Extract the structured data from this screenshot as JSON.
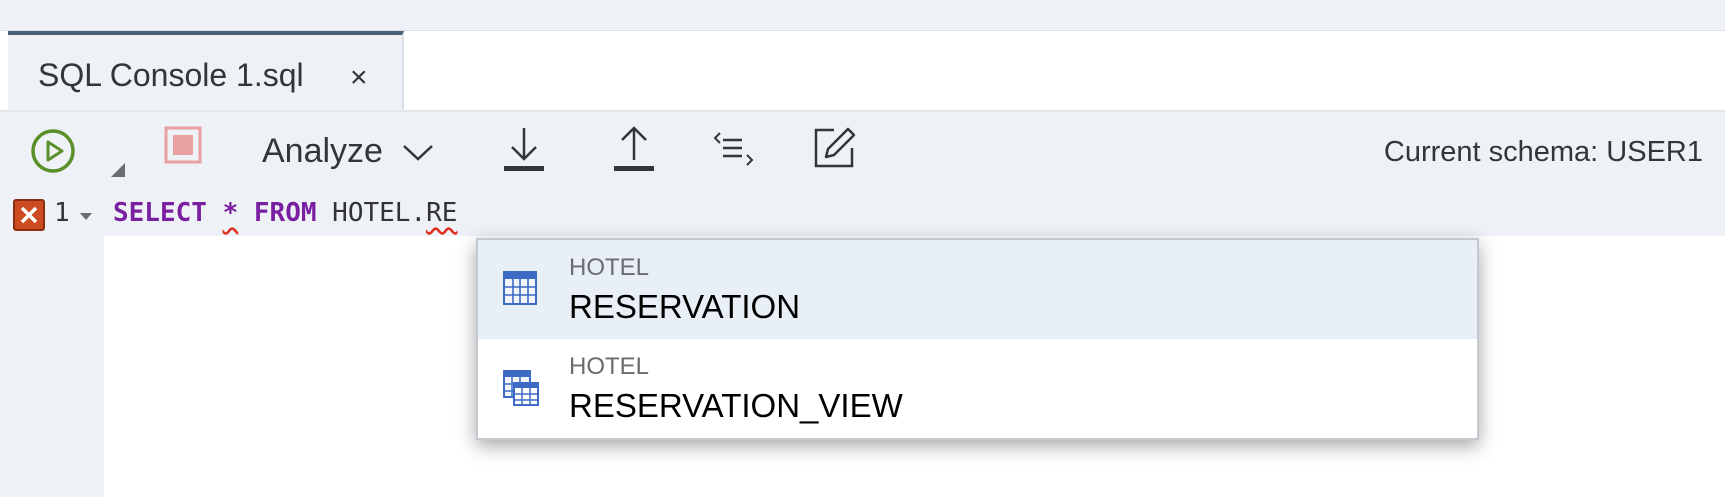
{
  "tabs": [
    {
      "label": "SQL Console 1.sql",
      "close": "×"
    }
  ],
  "toolbar": {
    "run_icon": "run-icon",
    "stop_icon": "stop-icon",
    "analyze_label": "Analyze",
    "download_icon": "download-icon",
    "upload_icon": "upload-icon",
    "format_icon": "format-code-icon",
    "edit_icon": "edit-icon",
    "current_schema": "Current schema: USER1"
  },
  "editor": {
    "line_number": "1",
    "code": {
      "select": "SELECT",
      "star": "*",
      "from": "FROM",
      "table_prefix": "HOTEL.",
      "partial": "RE"
    },
    "error_color": "#cc4b21"
  },
  "autocomplete": {
    "items": [
      {
        "schema": "HOTEL",
        "name": "RESERVATION",
        "icon": "table-icon",
        "selected": true
      },
      {
        "schema": "HOTEL",
        "name": "RESERVATION_VIEW",
        "icon": "view-icon",
        "selected": false
      }
    ]
  },
  "colors": {
    "keyword": "#7b1fa2",
    "run_green": "#5b8f2a",
    "stop_red": "#e8a0a0",
    "tab_accent": "#475e75",
    "selection": "#e8eff7"
  }
}
